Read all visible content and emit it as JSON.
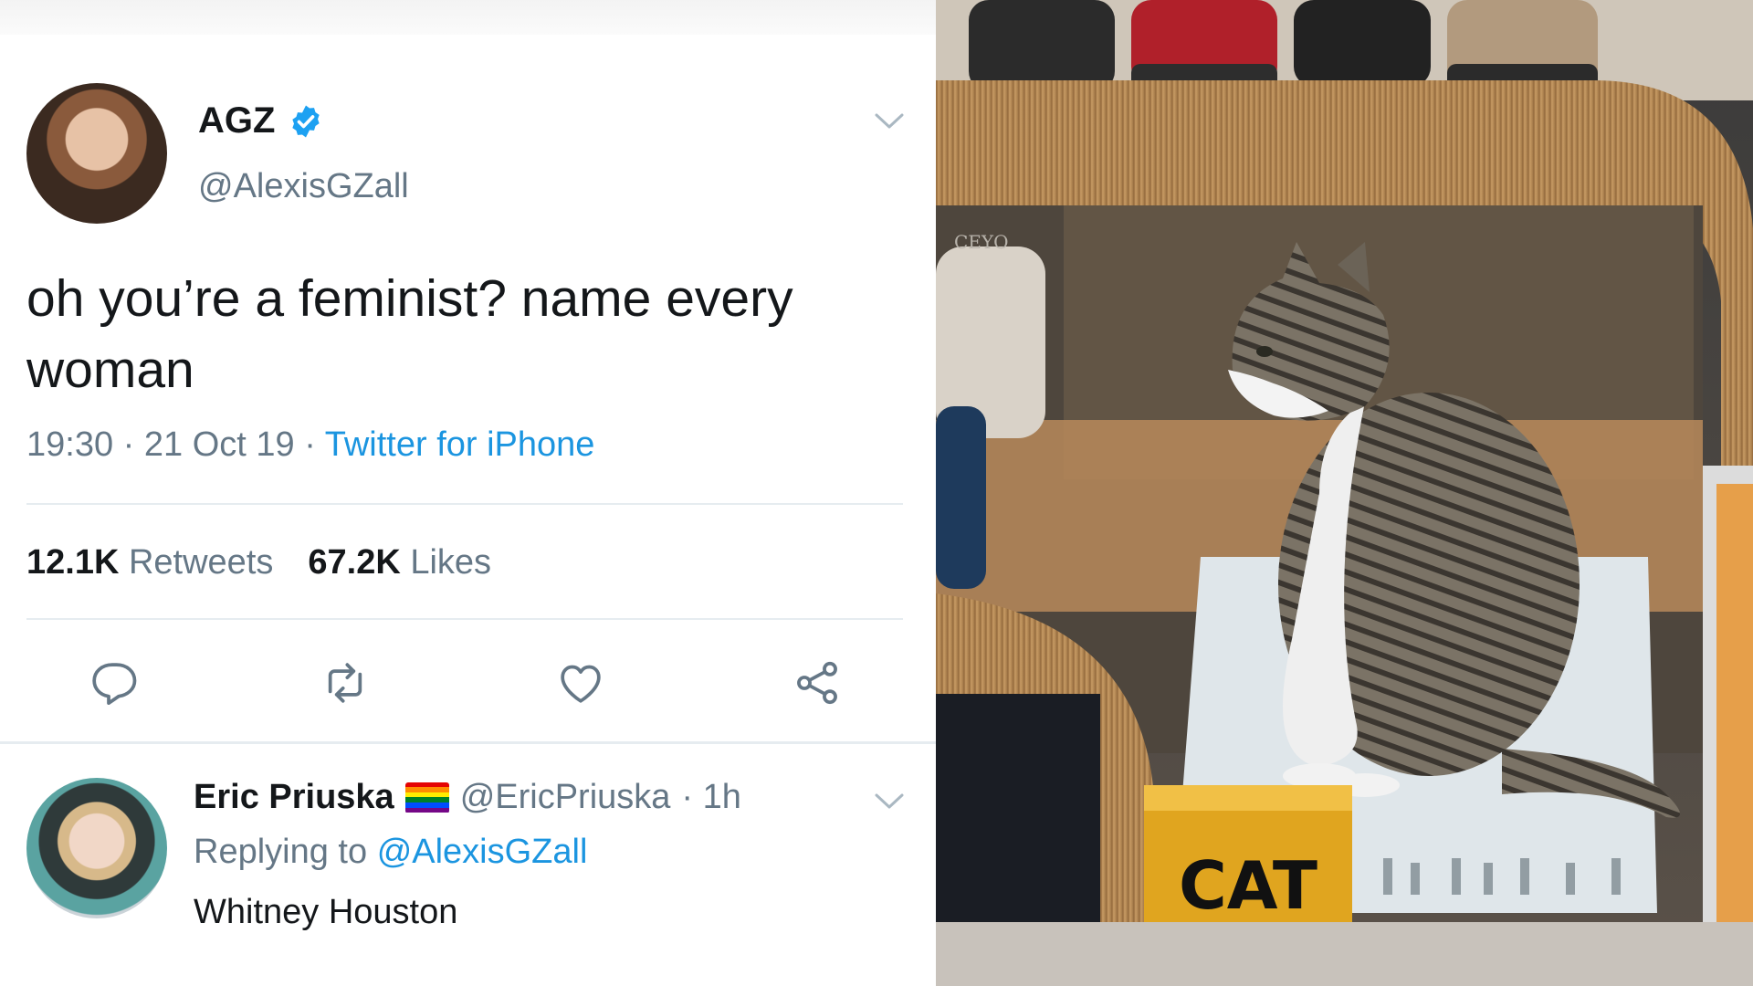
{
  "tweet": {
    "display_name": "AGZ",
    "handle": "@AlexisGZall",
    "text": "oh you’re a feminist? name every woman",
    "time": "19:30",
    "date": "21 Oct 19",
    "separator": "·",
    "source": "Twitter for iPhone",
    "retweets_count": "12.1K",
    "retweets_label": "Retweets",
    "likes_count": "67.2K",
    "likes_label": "Likes"
  },
  "reply": {
    "display_name": "Eric Priuska",
    "handle": "@EricPriuska",
    "age": "· 1h",
    "replying_label": "Replying to",
    "replying_to": "@AlexisGZall",
    "text": "Whitney Houston"
  },
  "photo": {
    "store_label": "CEYO",
    "box_brand": "CAT"
  },
  "colors": {
    "link": "#1b95e0",
    "verified": "#1da1f2",
    "secondary_text": "#657786",
    "primary_text": "#14171a"
  },
  "icons": [
    "verified-badge-icon",
    "chevron-down-icon",
    "reply-icon",
    "retweet-icon",
    "like-icon",
    "share-icon",
    "rainbow-flag-icon"
  ]
}
